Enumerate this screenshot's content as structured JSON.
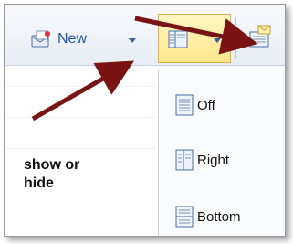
{
  "toolbar": {
    "new_label": "New"
  },
  "menu": {
    "items": [
      {
        "label": "Off",
        "icon": "reading-pane-off-icon"
      },
      {
        "label": "Right",
        "icon": "reading-pane-right-icon"
      },
      {
        "label": "Bottom",
        "icon": "reading-pane-bottom-icon"
      }
    ]
  },
  "annotation": {
    "text": "show or\nhide"
  },
  "colors": {
    "accent": "#1f56b5",
    "highlight": "#ffe68a",
    "arrow": "#7a1414"
  }
}
